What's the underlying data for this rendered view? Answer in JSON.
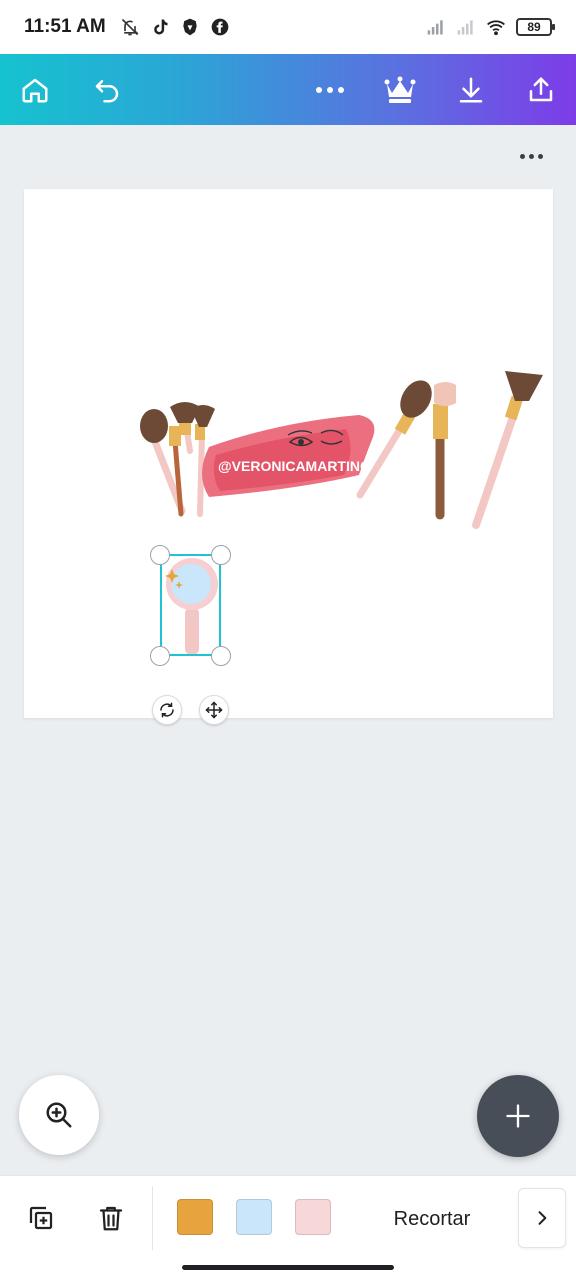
{
  "status_bar": {
    "time": "11:51 AM",
    "battery": "89",
    "icons_left": [
      "bell-off-icon",
      "tiktok-icon",
      "brave-icon",
      "facebook-icon"
    ],
    "icons_right": [
      "signal-icon",
      "signal-icon",
      "wifi-icon",
      "battery-icon"
    ]
  },
  "toolbar": {
    "gradient": [
      "#16c2cf",
      "#7d3ce8"
    ],
    "buttons": [
      "home-icon",
      "undo-icon",
      "more-icon",
      "crown-icon",
      "download-icon",
      "share-icon"
    ]
  },
  "canvas": {
    "watermark_text": "@VERONICAMARTINC",
    "selection_color": "#1fc3d3"
  },
  "bottom_bar": {
    "swatches": [
      "#e7a33e",
      "#c9e6fa",
      "#f8d7d8"
    ],
    "crop_label": "Recortar"
  }
}
